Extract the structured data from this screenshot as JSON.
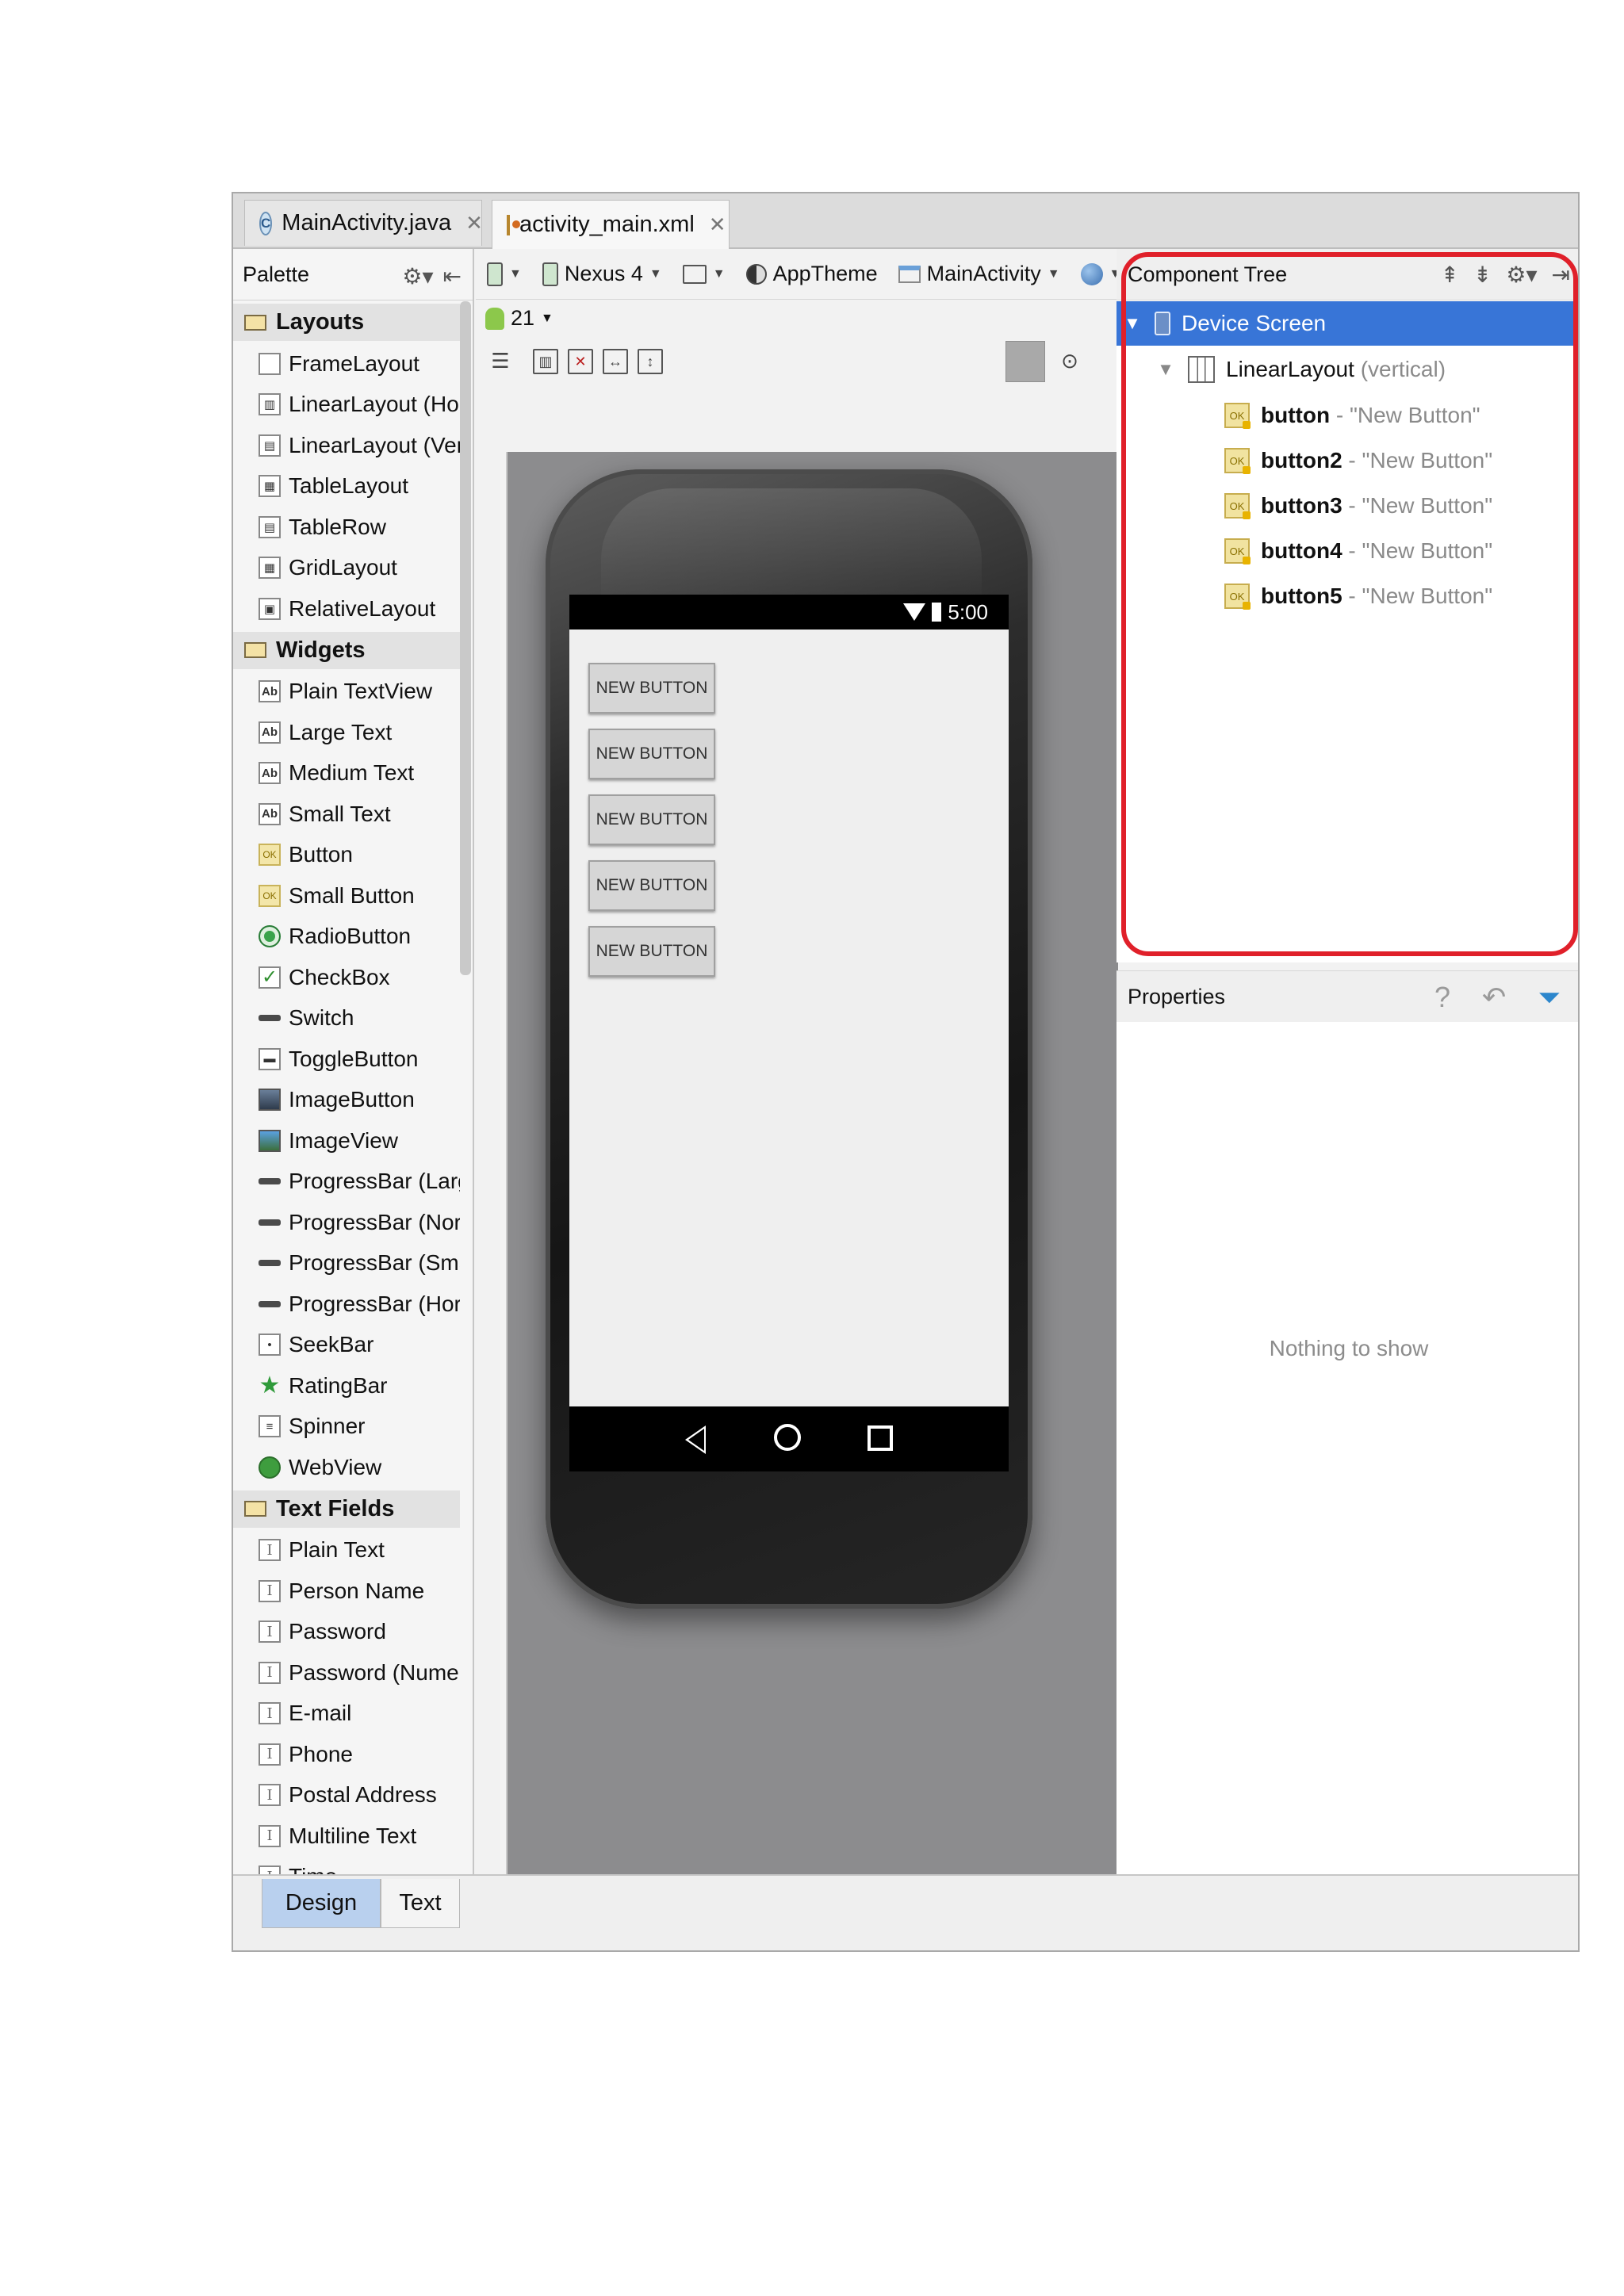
{
  "editor_tabs": [
    {
      "label": "MainActivity.java",
      "icon": "java-class-icon"
    },
    {
      "label": "activity_main.xml",
      "icon": "xml-layout-icon"
    }
  ],
  "palette": {
    "title": "Palette",
    "categories": [
      {
        "name": "Layouts",
        "items": [
          {
            "label": "FrameLayout",
            "icon": "frame-layout-icon"
          },
          {
            "label": "LinearLayout (Hor",
            "icon": "linear-layout-horizontal-icon"
          },
          {
            "label": "LinearLayout (Vert",
            "icon": "linear-layout-vertical-icon"
          },
          {
            "label": "TableLayout",
            "icon": "table-layout-icon"
          },
          {
            "label": "TableRow",
            "icon": "table-row-icon"
          },
          {
            "label": "GridLayout",
            "icon": "grid-layout-icon"
          },
          {
            "label": "RelativeLayout",
            "icon": "relative-layout-icon"
          }
        ]
      },
      {
        "name": "Widgets",
        "items": [
          {
            "label": "Plain TextView",
            "icon": "textview-icon"
          },
          {
            "label": "Large Text",
            "icon": "textview-icon"
          },
          {
            "label": "Medium Text",
            "icon": "textview-icon"
          },
          {
            "label": "Small Text",
            "icon": "textview-icon"
          },
          {
            "label": "Button",
            "icon": "button-icon"
          },
          {
            "label": "Small Button",
            "icon": "button-icon"
          },
          {
            "label": "RadioButton",
            "icon": "radio-button-icon"
          },
          {
            "label": "CheckBox",
            "icon": "checkbox-icon"
          },
          {
            "label": "Switch",
            "icon": "switch-icon"
          },
          {
            "label": "ToggleButton",
            "icon": "toggle-button-icon"
          },
          {
            "label": "ImageButton",
            "icon": "image-button-icon"
          },
          {
            "label": "ImageView",
            "icon": "image-view-icon"
          },
          {
            "label": "ProgressBar (Large",
            "icon": "progress-bar-icon"
          },
          {
            "label": "ProgressBar (Norm",
            "icon": "progress-bar-icon"
          },
          {
            "label": "ProgressBar (Smal",
            "icon": "progress-bar-icon"
          },
          {
            "label": "ProgressBar (Horiz",
            "icon": "progress-bar-icon"
          },
          {
            "label": "SeekBar",
            "icon": "seekbar-icon"
          },
          {
            "label": "RatingBar",
            "icon": "rating-star-icon"
          },
          {
            "label": "Spinner",
            "icon": "spinner-icon"
          },
          {
            "label": "WebView",
            "icon": "webview-globe-icon"
          }
        ]
      },
      {
        "name": "Text Fields",
        "items": [
          {
            "label": "Plain Text",
            "icon": "text-field-icon"
          },
          {
            "label": "Person Name",
            "icon": "text-field-icon"
          },
          {
            "label": "Password",
            "icon": "text-field-icon"
          },
          {
            "label": "Password (Numeri",
            "icon": "text-field-icon"
          },
          {
            "label": "E-mail",
            "icon": "text-field-icon"
          },
          {
            "label": "Phone",
            "icon": "text-field-icon"
          },
          {
            "label": "Postal Address",
            "icon": "text-field-icon"
          },
          {
            "label": "Multiline Text",
            "icon": "text-field-icon"
          },
          {
            "label": "Time",
            "icon": "text-field-icon"
          }
        ]
      }
    ]
  },
  "toolbar": {
    "device": "Nexus 4",
    "theme": "AppTheme",
    "activity": "MainActivity",
    "api_level": "21"
  },
  "phone": {
    "clock": "5:00",
    "buttons": [
      "NEW BUTTON",
      "NEW BUTTON",
      "NEW BUTTON",
      "NEW BUTTON",
      "NEW BUTTON"
    ]
  },
  "component_tree": {
    "title": "Component Tree",
    "root": "Device Screen",
    "layout_name": "LinearLayout",
    "layout_orientation": "(vertical)",
    "buttons": [
      {
        "id": "button",
        "text": "\"New Button\""
      },
      {
        "id": "button2",
        "text": "\"New Button\""
      },
      {
        "id": "button3",
        "text": "\"New Button\""
      },
      {
        "id": "button4",
        "text": "\"New Button\""
      },
      {
        "id": "button5",
        "text": "\"New Button\""
      }
    ],
    "separator": "-",
    "highlight_color": "#e0202a",
    "selection_color": "#3875d7"
  },
  "properties": {
    "title": "Properties",
    "empty_message": "Nothing to show"
  },
  "bottom_tabs": [
    "Design",
    "Text"
  ]
}
